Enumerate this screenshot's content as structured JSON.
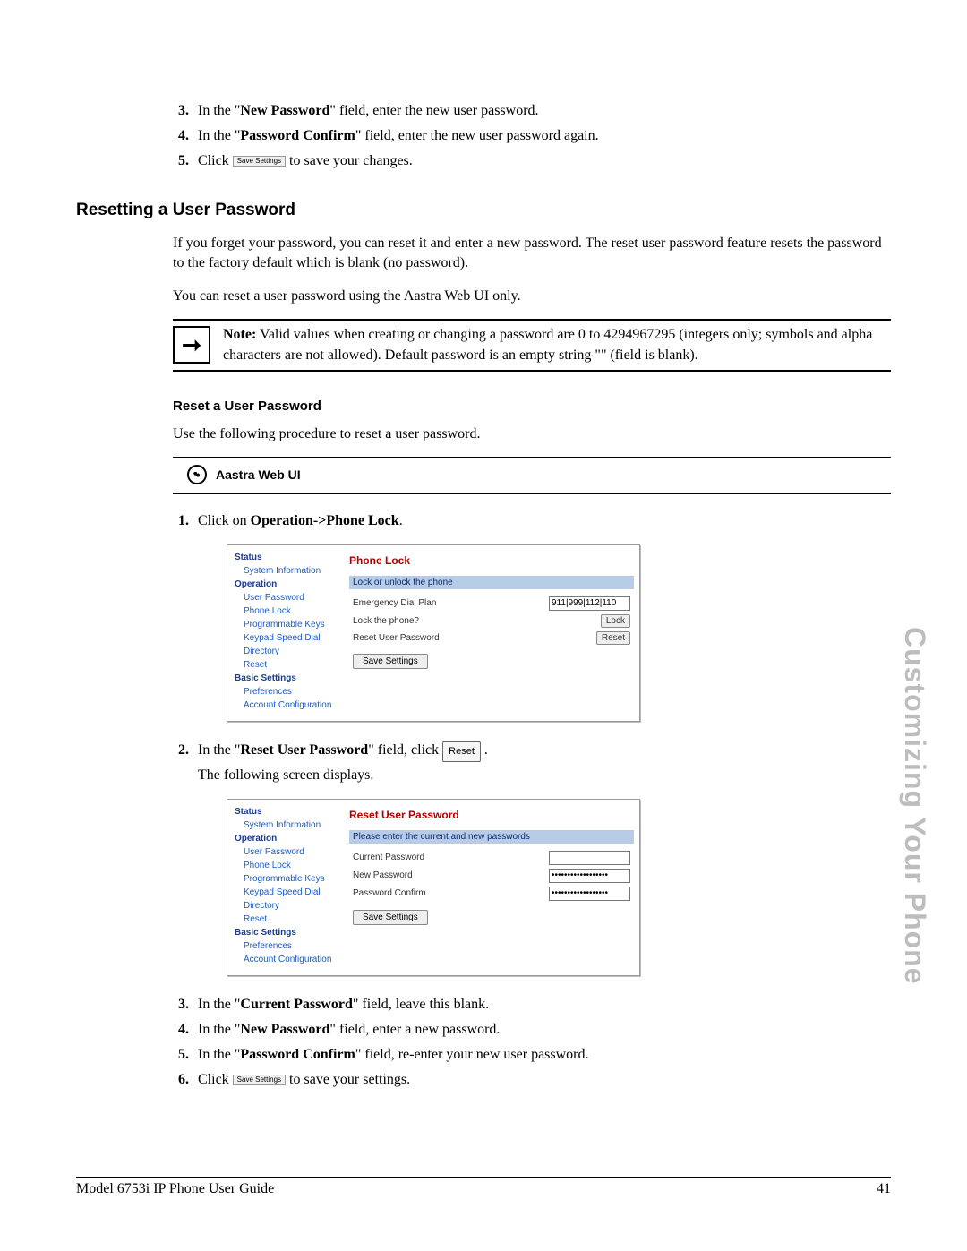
{
  "sidelabel": "Customizing Your Phone",
  "top_steps": [
    {
      "pre": "In the \"",
      "bold": "New Password",
      "post": "\" field, enter the new user password."
    },
    {
      "pre": "In the \"",
      "bold": "Password Confirm",
      "post": "\" field, enter the new user password again."
    },
    {
      "click": "Click ",
      "button": "Save Settings",
      "post": " to save your changes."
    }
  ],
  "section_heading": "Resetting a User Password",
  "para1": "If you forget your password, you can reset it and enter a new password. The reset user password feature resets the password to the factory default which is blank (no password).",
  "para2": "You can reset a user password using the Aastra Web UI only.",
  "note_label": "Note:",
  "note_text": "Valid values when creating or changing a password are 0 to 4294967295 (integers only; symbols and alpha characters are not allowed). Default password is an empty string \"\" (field is blank).",
  "sub_heading": "Reset a User Password",
  "sub_intro": "Use the following procedure to reset a user password.",
  "webui_label": "Aastra Web UI",
  "step1": {
    "pre": "Click on ",
    "bold": "Operation->Phone Lock",
    "post": "."
  },
  "shot1": {
    "nav": {
      "status": "Status",
      "status_items": [
        "System Information"
      ],
      "operation": "Operation",
      "op_items": [
        "User Password",
        "Phone Lock",
        "Programmable Keys",
        "Keypad Speed Dial",
        "Directory",
        "Reset"
      ],
      "basic": "Basic Settings",
      "basic_items": [
        "Preferences",
        "Account Configuration"
      ]
    },
    "title": "Phone Lock",
    "bar": "Lock or unlock the phone",
    "rows": [
      {
        "label": "Emergency Dial Plan",
        "value": "911|999|112|110",
        "type": "text"
      },
      {
        "label": "Lock the phone?",
        "button": "Lock"
      },
      {
        "label": "Reset User Password",
        "button": "Reset"
      }
    ],
    "save": "Save Settings"
  },
  "step2": {
    "pre": "In the \"",
    "bold": "Reset User Password",
    "mid": "\" field, click ",
    "btn": "Reset",
    "post": " .",
    "line2": "The following screen displays."
  },
  "shot2": {
    "title": "Reset User Password",
    "bar": "Please enter the current and new passwords",
    "rows": [
      {
        "label": "Current Password",
        "value": ""
      },
      {
        "label": "New Password",
        "value": "••••••••••••••••••"
      },
      {
        "label": "Password Confirm",
        "value": "••••••••••••••••••"
      }
    ],
    "save": "Save Settings"
  },
  "bottom_steps": [
    {
      "pre": "In the \"",
      "bold": "Current Password",
      "post": "\" field, leave this blank."
    },
    {
      "pre": "In the \"",
      "bold": "New Password",
      "post": "\" field, enter a new password."
    },
    {
      "pre": "In the \"",
      "bold": "Password Confirm",
      "post": "\" field, re-enter your new user password."
    },
    {
      "click": "Click ",
      "button": "Save Settings",
      "post": " to save your settings."
    }
  ],
  "footer_left": "Model 6753i IP Phone User Guide",
  "footer_right": "41"
}
